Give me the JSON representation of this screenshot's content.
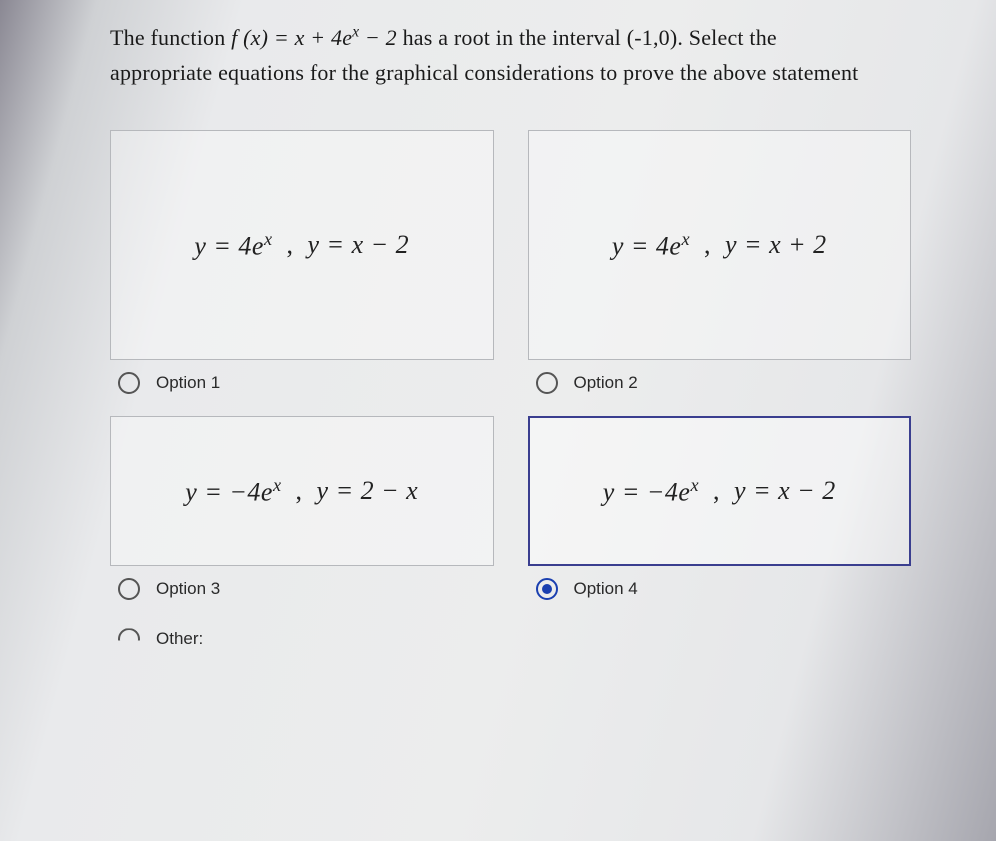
{
  "question": {
    "part1": "The function  ",
    "fx": "f (x) = x + 4e",
    "fx_sup": "x",
    "fx_tail": " − 2",
    "part2": "  has a root in the interval (-1,0). Select the",
    "line2": "appropriate equations for the graphical considerations to prove the above statement"
  },
  "options": [
    {
      "id": "opt1",
      "label": "Option 1",
      "selected": false,
      "eq1_a": "y = 4e",
      "eq1_sup": "x",
      "eq2": "y = x − 2"
    },
    {
      "id": "opt2",
      "label": "Option 2",
      "selected": false,
      "eq1_a": "y = 4e",
      "eq1_sup": "x",
      "eq2": "y = x + 2"
    },
    {
      "id": "opt3",
      "label": "Option 3",
      "selected": false,
      "eq1_a": "y = −4e",
      "eq1_sup": "x",
      "eq2": "y = 2 − x"
    },
    {
      "id": "opt4",
      "label": "Option 4",
      "selected": true,
      "eq1_a": "y = −4e",
      "eq1_sup": "x",
      "eq2": "y = x − 2"
    }
  ],
  "other_label": "Other:",
  "sep": ","
}
